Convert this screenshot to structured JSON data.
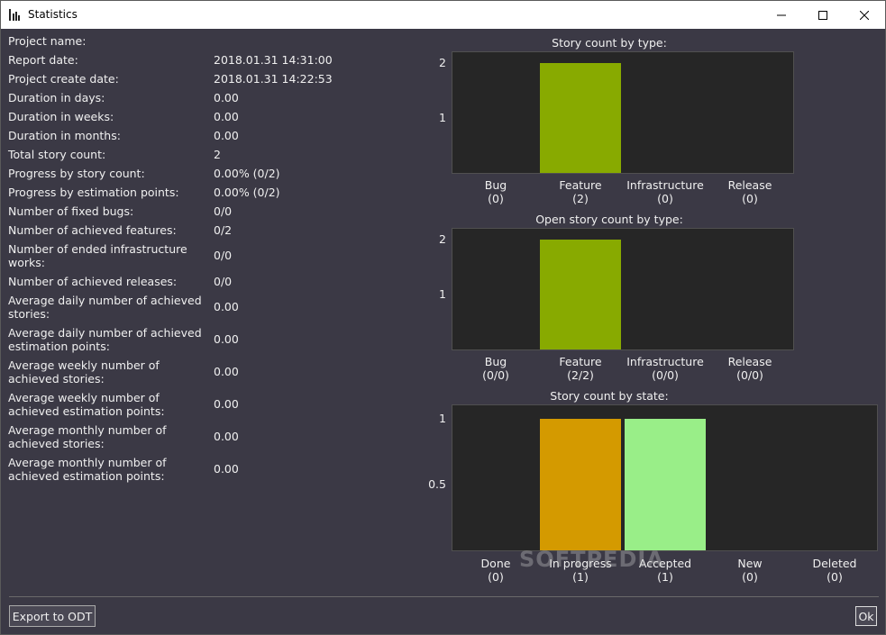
{
  "window": {
    "title": "Statistics",
    "icon": "bar-chart-icon",
    "controls": [
      "minimize-icon",
      "maximize-icon",
      "close-icon"
    ]
  },
  "stats": [
    {
      "label": "Project name:",
      "value": ""
    },
    {
      "label": "Report date:",
      "value": "2018.01.31 14:31:00"
    },
    {
      "label": "Project create date:",
      "value": "2018.01.31 14:22:53"
    },
    {
      "label": "Duration in days:",
      "value": "0.00"
    },
    {
      "label": "Duration in weeks:",
      "value": "0.00"
    },
    {
      "label": "Duration in months:",
      "value": "0.00"
    },
    {
      "label": "Total story count:",
      "value": "2"
    },
    {
      "label": "Progress by story count:",
      "value": "0.00% (0/2)"
    },
    {
      "label": "Progress by estimation points:",
      "value": "0.00% (0/2)"
    },
    {
      "label": "Number of fixed bugs:",
      "value": "0/0"
    },
    {
      "label": "Number of achieved features:",
      "value": "0/2"
    },
    {
      "label": "Number of ended infrastructure works:",
      "value": "0/0"
    },
    {
      "label": "Number of achieved releases:",
      "value": "0/0"
    },
    {
      "label": "Average daily number of achieved stories:",
      "value": "0.00"
    },
    {
      "label": "Average daily number of achieved estimation points:",
      "value": "0.00"
    },
    {
      "label": "Average weekly number of achieved stories:",
      "value": "0.00"
    },
    {
      "label": "Average weekly number of achieved estimation points:",
      "value": "0.00"
    },
    {
      "label": "Average monthly number of achieved stories:",
      "value": "0.00"
    },
    {
      "label": "Average monthly number of achieved estimation points:",
      "value": "0.00"
    }
  ],
  "chart_data": [
    {
      "type": "bar",
      "title": "Story count by type:",
      "categories": [
        "Bug",
        "Feature",
        "Infrastructure",
        "Release"
      ],
      "category_sublabels": [
        "(0)",
        "(2)",
        "(0)",
        "(0)"
      ],
      "values": [
        0,
        2,
        0,
        0
      ],
      "yticks": [
        "1",
        "2"
      ],
      "ytick_values": [
        1,
        2
      ],
      "ylim": [
        0,
        2.2
      ],
      "colors": [
        "#88aa00",
        "#88aa00",
        "#88aa00",
        "#88aa00"
      ]
    },
    {
      "type": "bar",
      "title": "Open story count by type:",
      "categories": [
        "Bug",
        "Feature",
        "Infrastructure",
        "Release"
      ],
      "category_sublabels": [
        "(0/0)",
        "(2/2)",
        "(0/0)",
        "(0/0)"
      ],
      "values": [
        0,
        2,
        0,
        0
      ],
      "yticks": [
        "1",
        "2"
      ],
      "ytick_values": [
        1,
        2
      ],
      "ylim": [
        0,
        2.2
      ],
      "colors": [
        "#88aa00",
        "#88aa00",
        "#88aa00",
        "#88aa00"
      ]
    },
    {
      "type": "bar",
      "title": "Story count by state:",
      "categories": [
        "Done",
        "In progress",
        "Accepted",
        "New",
        "Deleted"
      ],
      "category_sublabels": [
        "(0)",
        "(1)",
        "(1)",
        "(0)",
        "(0)"
      ],
      "values": [
        0,
        1,
        1,
        0,
        0
      ],
      "yticks": [
        "0.5",
        "1"
      ],
      "ytick_values": [
        0.5,
        1
      ],
      "ylim": [
        0,
        1.1
      ],
      "colors": [
        "#cc8800",
        "#d49a00",
        "#99ee88",
        "#888888",
        "#888888"
      ]
    }
  ],
  "buttons": {
    "export": "Export to ODT",
    "ok": "Ok"
  },
  "watermark": "SOFTPEDIA"
}
